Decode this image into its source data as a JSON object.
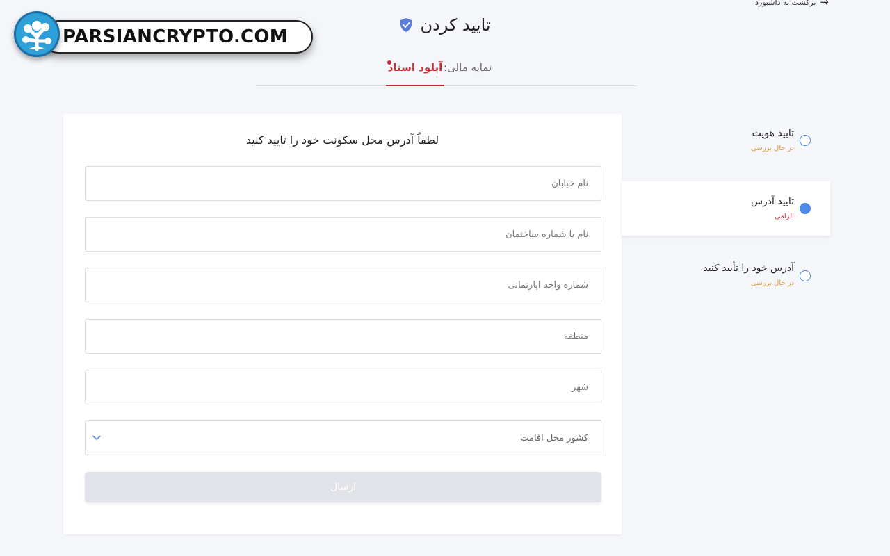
{
  "header": {
    "back_label": "برگشت به داشبورد",
    "title": "تایید کردن"
  },
  "watermark": {
    "text": "PARSIANCRYPTO.COM"
  },
  "tabs": [
    {
      "label": "نمایه مالی:",
      "active": false
    },
    {
      "label": "آپلود اسناد",
      "active": true
    }
  ],
  "form": {
    "title": "لطفاً آدرس محل سکونت خود را تایید کنید",
    "fields": [
      {
        "placeholder": "نام خیابان",
        "value": ""
      },
      {
        "placeholder": "نام یا شماره ساختمان",
        "value": ""
      },
      {
        "placeholder": "شماره واحد آپارتمانی",
        "value": ""
      },
      {
        "placeholder": "منطقه",
        "value": ""
      },
      {
        "placeholder": "شهر",
        "value": ""
      }
    ],
    "country_select": {
      "label": "کشور محل اقامت"
    },
    "submit_label": "ارسال"
  },
  "steps": [
    {
      "title": "تایید هویت",
      "status": "در حال بررسی",
      "active": false
    },
    {
      "title": "تایید آدرس",
      "status": "الزامی",
      "active": true
    },
    {
      "title": "آدرس خود را تأیید کنید",
      "status": "در حال بررسی",
      "active": false
    }
  ],
  "colors": {
    "accent_blue": "#4e8be6",
    "active_red": "#c0303a",
    "review_orange": "#e29a3a",
    "background": "#f4f6fa"
  },
  "icons": {
    "back": "arrow-right-icon",
    "title": "shield-check-icon",
    "select": "chevron-down-icon"
  }
}
